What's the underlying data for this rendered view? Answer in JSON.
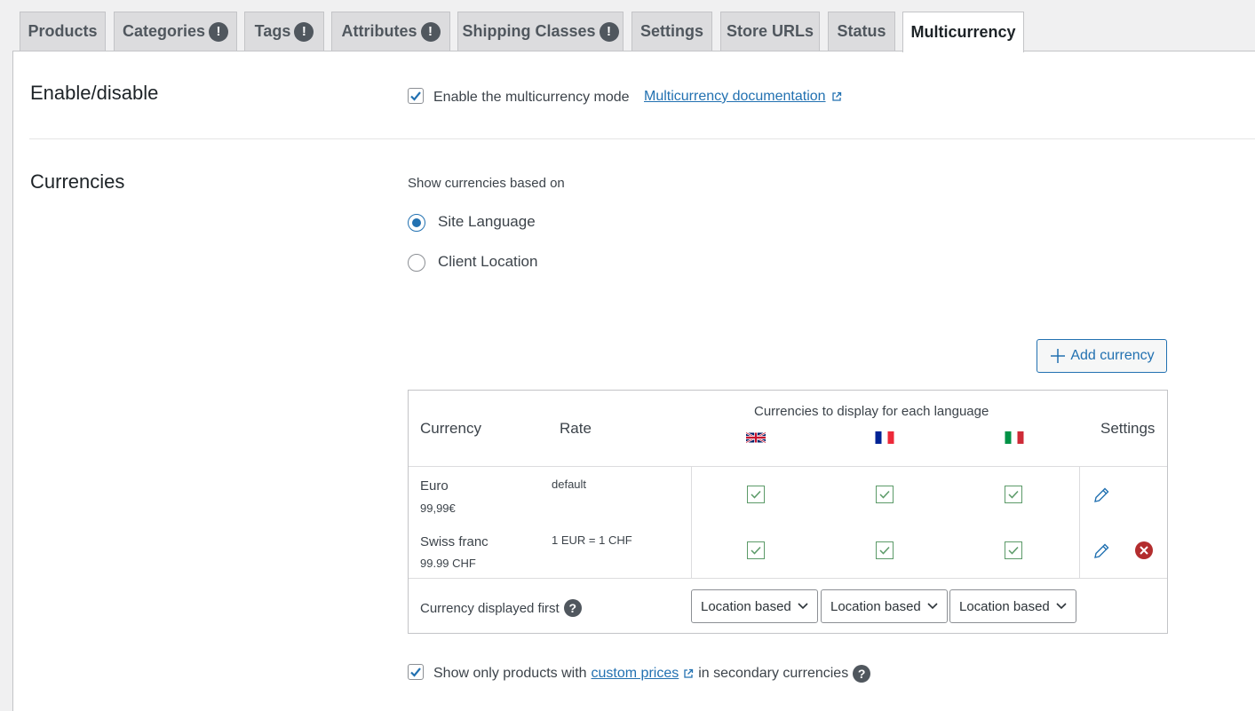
{
  "tabs": [
    {
      "label": "Products",
      "badge": ""
    },
    {
      "label": "Categories",
      "badge": "!"
    },
    {
      "label": "Tags",
      "badge": "!"
    },
    {
      "label": "Attributes",
      "badge": "!"
    },
    {
      "label": "Shipping Classes",
      "badge": "!"
    },
    {
      "label": "Settings",
      "badge": ""
    },
    {
      "label": "Store URLs",
      "badge": ""
    },
    {
      "label": "Status",
      "badge": ""
    },
    {
      "label": "Multicurrency",
      "badge": ""
    }
  ],
  "active_tab": "Multicurrency",
  "enable": {
    "title": "Enable/disable",
    "checkbox_label": "Enable the multicurrency mode",
    "checked": true,
    "doc_link": "Multicurrency documentation"
  },
  "currencies": {
    "title": "Currencies",
    "show_based_on": "Show currencies based on",
    "options": [
      "Site Language",
      "Client Location"
    ],
    "selected": "Site Language",
    "add_button": "Add currency"
  },
  "table": {
    "headers": {
      "currency": "Currency",
      "rate": "Rate",
      "languages": "Currencies to display for each language",
      "settings": "Settings"
    },
    "languages": [
      "English",
      "French",
      "Italian"
    ],
    "rows": [
      {
        "name": "Euro",
        "price": "99,99€",
        "rate": "default",
        "enabled": [
          true,
          true,
          true
        ],
        "removable": false
      },
      {
        "name": "Swiss franc",
        "price": "99.99 CHF",
        "rate": "1 EUR = 1 CHF",
        "enabled": [
          true,
          true,
          true
        ],
        "removable": true
      }
    ],
    "displayed_first_label": "Currency displayed first",
    "displayed_first_values": [
      "Location based",
      "Location based",
      "Location based"
    ]
  },
  "custom_prices": {
    "prefix": "Show only products with",
    "link": "custom prices",
    "suffix": "in secondary currencies",
    "checked": true
  },
  "colors": {
    "accent": "#2271b1",
    "check_green": "#5b9a68",
    "delete_red": "#b32d2e"
  }
}
